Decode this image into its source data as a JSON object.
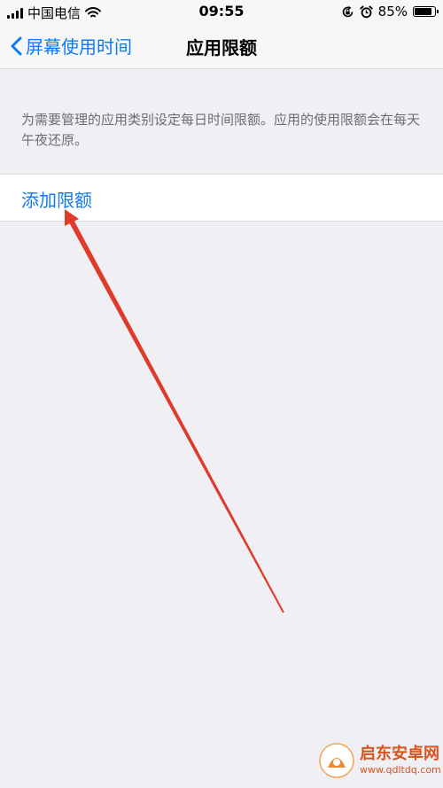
{
  "status_bar": {
    "carrier": "中国电信",
    "time": "09:55",
    "battery_percent": "85%",
    "battery_level": 0.85,
    "icons": [
      "signal-icon",
      "wifi-icon",
      "rotation-lock-icon",
      "alarm-icon",
      "battery-icon"
    ]
  },
  "nav": {
    "back_label": "屏幕使用时间",
    "title": "应用限额"
  },
  "description": "为需要管理的应用类别设定每日时间限额。应用的使用限额会在每天午夜还原。",
  "add_limit_label": "添加限额",
  "watermark": {
    "brand": "启东安卓网",
    "url": "www.qdltdq.com"
  },
  "colors": {
    "accent": "#1479ef",
    "back": "#0a7cf6",
    "annotation_arrow": "#e03a2a",
    "watermark": "#d9531e"
  }
}
